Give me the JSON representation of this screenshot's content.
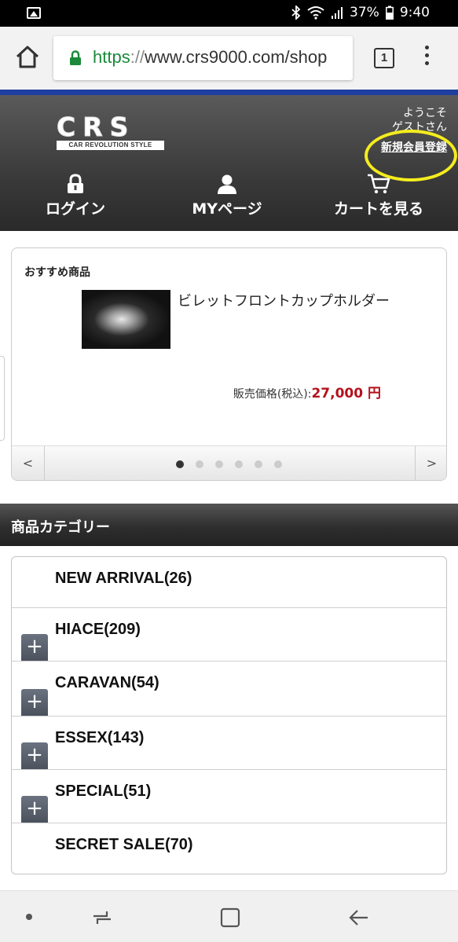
{
  "status_bar": {
    "battery": "37%",
    "time": "9:40"
  },
  "browser": {
    "url_scheme": "https",
    "url_sep": "://",
    "url_host": "www.crs9000.com/shop",
    "tab_count": "1"
  },
  "header": {
    "logo_text": "CRS",
    "logo_tagline": "CAR REVOLUTION STYLE",
    "welcome_line1": "ようこそ",
    "welcome_line2": "ゲストさん",
    "register_link": "新規会員登録",
    "nav": {
      "login": "ログイン",
      "mypage": "MYページ",
      "cart": "カートを見る"
    }
  },
  "recommended": {
    "title": "おすすめ商品",
    "product_name": "ビレットフロントカップホルダー",
    "price_label": "販売価格(税込):",
    "price": "27,000 円",
    "prev": "<",
    "next": ">",
    "total_slides": 6,
    "active_slide": 1
  },
  "categories": {
    "title": "商品カテゴリー",
    "items": [
      {
        "label": "NEW ARRIVAL(26)",
        "expandable": false
      },
      {
        "label": "HIACE(209)",
        "expandable": true
      },
      {
        "label": "CARAVAN(54)",
        "expandable": true
      },
      {
        "label": "ESSEX(143)",
        "expandable": true
      },
      {
        "label": "SPECIAL(51)",
        "expandable": true
      },
      {
        "label": "SECRET SALE(70)",
        "expandable": false
      }
    ],
    "expand_symbol": "+"
  },
  "colors": {
    "header_accent": "#1f3fa0",
    "price": "#b3121c",
    "highlight_ring": "#f4ec1e",
    "url_scheme": "#1a8a3a"
  }
}
